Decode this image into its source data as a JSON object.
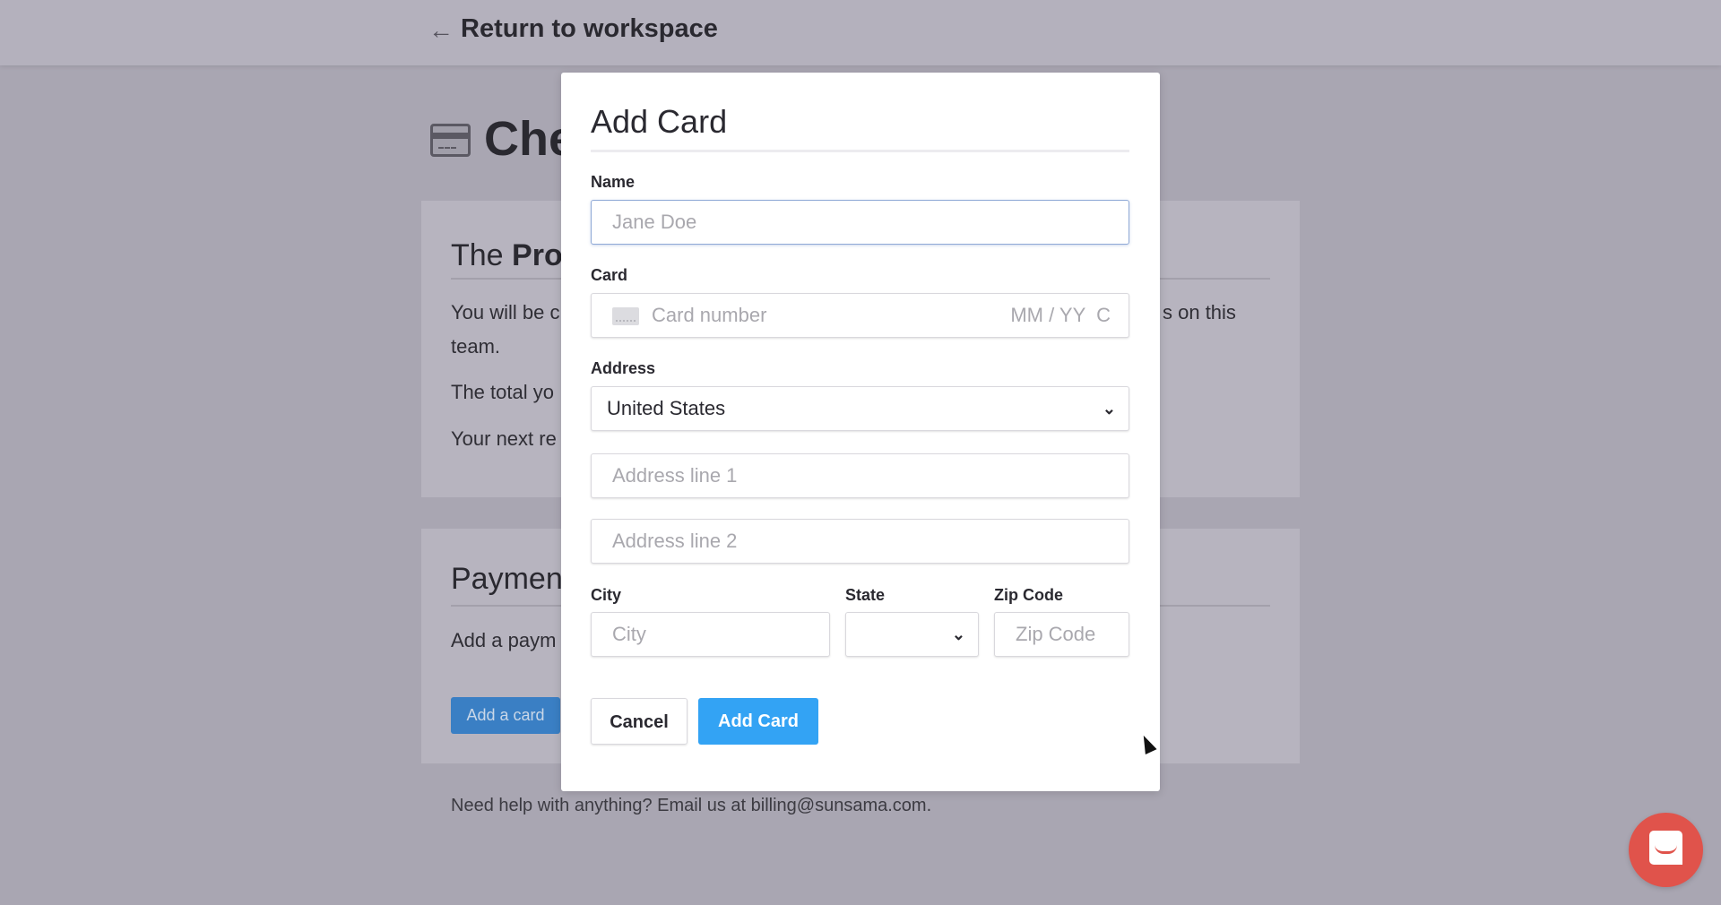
{
  "header": {
    "back_label": "Return to workspace",
    "back_icon": "arrow-left-icon"
  },
  "page": {
    "title_fragment": "Che",
    "plan_panel": {
      "title_prefix": "The ",
      "title_bold": "Pro",
      "line1_left": "You will be c",
      "line1_right": "s on this",
      "line2": "team.",
      "line3": "The total yo",
      "line4": "Your next re"
    },
    "payment_panel": {
      "title": "Paymen",
      "text": "Add a paym",
      "button": "Add a card"
    },
    "footer": "Need help with anything? Email us at billing@sunsama.com."
  },
  "modal": {
    "title": "Add Card",
    "name_label": "Name",
    "name_placeholder": "Jane Doe",
    "card_label": "Card",
    "card_placeholder": "Card number",
    "card_expiry_placeholder": "MM / YY  C",
    "address_label": "Address",
    "country": "United States",
    "address1_placeholder": "Address line 1",
    "address2_placeholder": "Address line 2",
    "city_label": "City",
    "city_placeholder": "City",
    "state_label": "State",
    "state_value": "",
    "zip_label": "Zip Code",
    "zip_placeholder": "Zip Code",
    "cancel": "Cancel",
    "submit": "Add Card"
  },
  "colors": {
    "accent": "#33a3f4",
    "chat": "#e0534b",
    "overlay": "#a9a6b2"
  }
}
